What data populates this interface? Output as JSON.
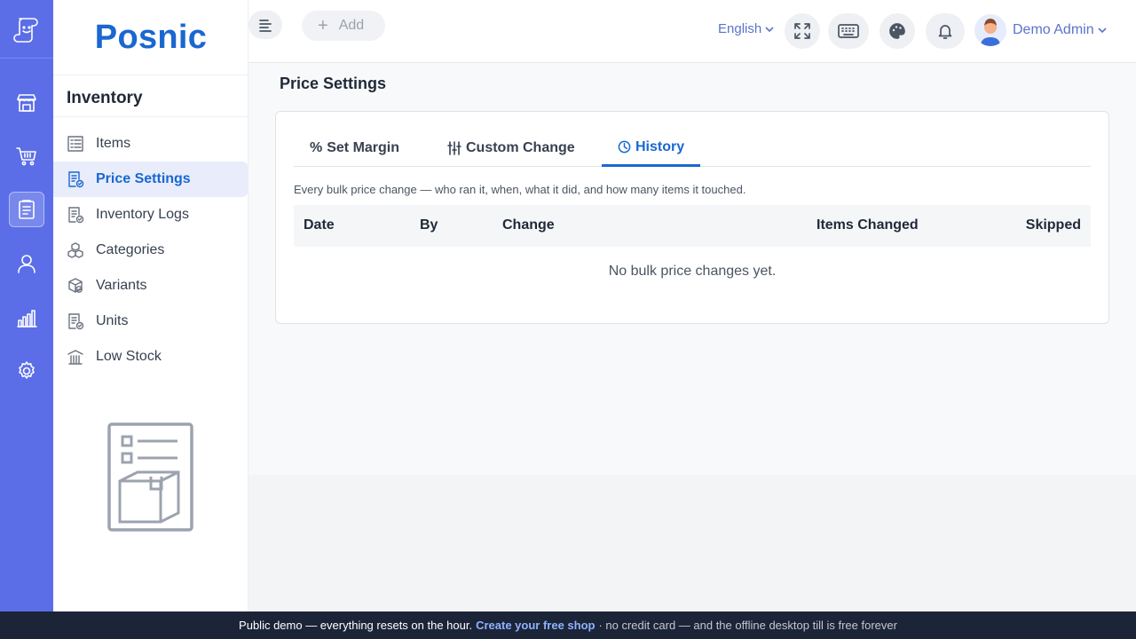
{
  "app": {
    "brand": "Posnic"
  },
  "rail": {
    "items": [
      {
        "icon": "store-icon"
      },
      {
        "icon": "cart-icon"
      },
      {
        "icon": "clipboard-icon",
        "active": true
      },
      {
        "icon": "user-icon"
      },
      {
        "icon": "bar-chart-icon"
      },
      {
        "icon": "gear-icon"
      }
    ]
  },
  "sidebar": {
    "title": "Inventory",
    "items": [
      {
        "label": "Items",
        "icon": "items-icon"
      },
      {
        "label": "Price Settings",
        "icon": "price-settings-icon",
        "active": true
      },
      {
        "label": "Inventory Logs",
        "icon": "inventory-logs-icon"
      },
      {
        "label": "Categories",
        "icon": "categories-icon"
      },
      {
        "label": "Variants",
        "icon": "variants-icon"
      },
      {
        "label": "Units",
        "icon": "units-icon"
      },
      {
        "label": "Low Stock",
        "icon": "low-stock-icon"
      }
    ]
  },
  "header": {
    "add_label": "Add",
    "language": "English",
    "user_name": "Demo Admin"
  },
  "main": {
    "page_title": "Price Settings",
    "tabs": [
      {
        "label": "Set Margin",
        "icon": "percent-icon"
      },
      {
        "label": "Custom Change",
        "icon": "sliders-icon"
      },
      {
        "label": "History",
        "icon": "clock-icon",
        "active": true
      }
    ],
    "description": "Every bulk price change — who ran it, when, what it did, and how many items it touched.",
    "table": {
      "columns": [
        "Date",
        "By",
        "Change",
        "Items Changed",
        "Skipped"
      ],
      "empty_text": "No bulk price changes yet."
    }
  },
  "footer": {
    "text": "Public demo — everything resets on the hour.",
    "link": "Create your free shop",
    "rest": "· no credit card — and the offline desktop till is free forever"
  },
  "colors": {
    "rail": "#5b6ee8",
    "accent": "#1a67d2",
    "footer": "#1c2438"
  }
}
